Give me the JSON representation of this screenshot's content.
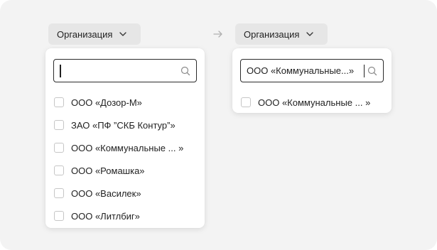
{
  "left": {
    "chip_label": "Организация",
    "search_value": "",
    "options": [
      "ООО «Дозор-М»",
      "ЗАО «ПФ ”СКБ Контур”»",
      "ООО «Коммунальные ... »",
      "ООО «Ромашка»",
      "ООО «Василек»",
      "ООО «Литлбиг»"
    ]
  },
  "right": {
    "chip_label": "Организация",
    "search_value": "ООО «Коммунальные...»",
    "options": [
      "ООО «Коммунальные ... »"
    ]
  },
  "icons": {
    "chevron": "chevron-down-icon",
    "search": "search-icon",
    "arrow": "arrow-right-icon"
  },
  "colors": {
    "canvas": "#f3f3f3",
    "chip": "#e6e6e6",
    "panel": "#ffffff",
    "input_border": "#2b2b2b",
    "checkbox_border": "#c6c6c6",
    "arrow": "#b0b0b0"
  }
}
